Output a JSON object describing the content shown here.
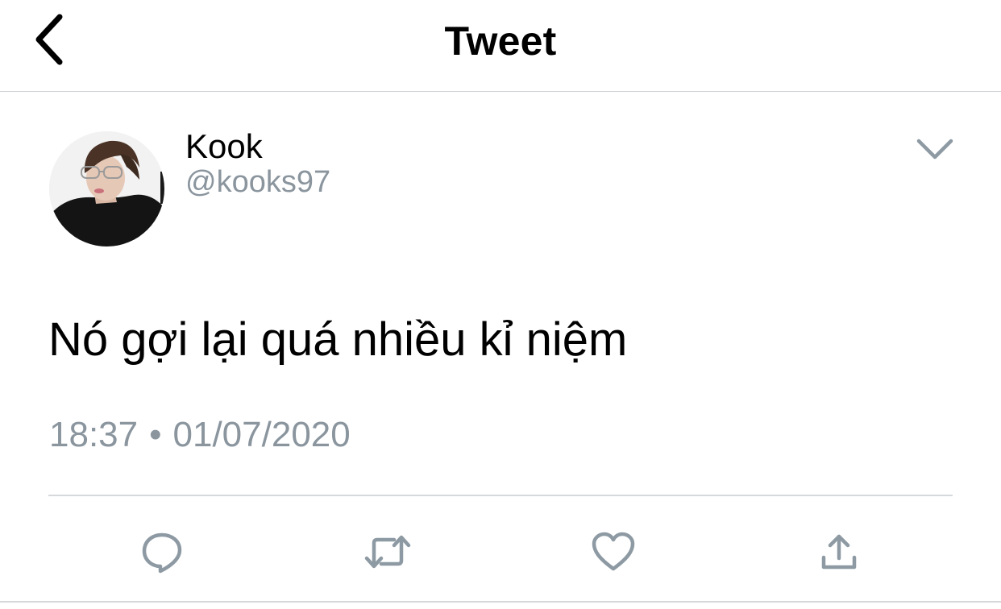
{
  "header": {
    "title": "Tweet",
    "back_icon": "chevron-left-icon"
  },
  "tweet": {
    "author": {
      "name": "Kook",
      "handle": "@kooks97"
    },
    "more_icon": "chevron-down-icon",
    "text": "Nó gợi lại quá nhiều kỉ niệm",
    "time": "18:37",
    "separator": "•",
    "date": "01/07/2020"
  },
  "actions": [
    {
      "icon": "reply-icon"
    },
    {
      "icon": "retweet-icon"
    },
    {
      "icon": "like-icon"
    },
    {
      "icon": "share-icon"
    }
  ],
  "colors": {
    "text": "#000000",
    "secondary": "#8a959e",
    "icon_gray": "#8e9aa3",
    "divider": "#d5d9dc"
  }
}
